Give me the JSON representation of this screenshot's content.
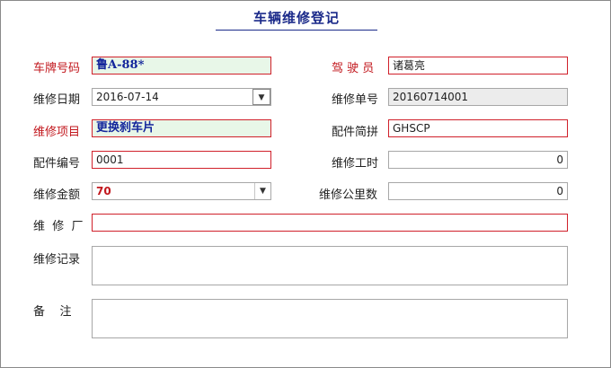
{
  "form": {
    "title": "车辆维修登记",
    "fields": {
      "plate": {
        "label": "车牌号码",
        "value": "鲁A-88*"
      },
      "driver": {
        "label": "驾 驶 员",
        "value": "诸葛亮"
      },
      "repair_date": {
        "label": "维修日期",
        "value": "2016-07-14"
      },
      "repair_no": {
        "label": "维修单号",
        "value": "20160714001"
      },
      "repair_item": {
        "label": "维修项目",
        "value": "更换刹车片"
      },
      "part_pinyin": {
        "label": "配件简拼",
        "value": "GHSCP"
      },
      "part_no": {
        "label": "配件编号",
        "value": "0001"
      },
      "labor_hours": {
        "label": "维修工时",
        "value": "0"
      },
      "amount": {
        "label": "维修金额",
        "value": "70"
      },
      "mileage": {
        "label": "维修公里数",
        "value": "0"
      },
      "factory": {
        "label": "维  修  厂",
        "value": ""
      },
      "record": {
        "label": "维修记录",
        "value": ""
      },
      "remark": {
        "label": "备    注",
        "value": ""
      }
    }
  },
  "icons": {
    "dropdown": "chevron-down-icon"
  },
  "colors": {
    "required_label": "#c2171d",
    "title": "#1b2a8a",
    "field_highlight": "#e8f7e8",
    "readonly": "#ececec"
  }
}
